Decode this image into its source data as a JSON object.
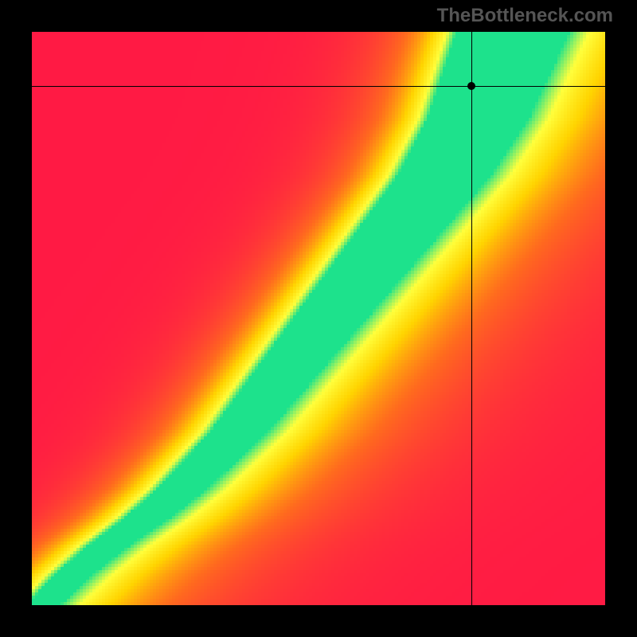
{
  "watermark": "TheBottleneck.com",
  "chart_data": {
    "type": "heatmap",
    "title": "",
    "xlabel": "",
    "ylabel": "",
    "xlim": [
      0,
      1
    ],
    "ylim": [
      0,
      1
    ],
    "grid": false,
    "legend": false,
    "colormap": [
      {
        "t": 0.0,
        "color": "#ff1a44"
      },
      {
        "t": 0.28,
        "color": "#ff6a1e"
      },
      {
        "t": 0.55,
        "color": "#ffd400"
      },
      {
        "t": 0.78,
        "color": "#ffff3c"
      },
      {
        "t": 1.0,
        "color": "#1de28c"
      }
    ],
    "ridge": {
      "description": "Green ridge path (x as function of y), value=1 along this curve, falloff with distance",
      "points": [
        {
          "y": 0.0,
          "x": 0.02
        },
        {
          "y": 0.05,
          "x": 0.07
        },
        {
          "y": 0.1,
          "x": 0.13
        },
        {
          "y": 0.15,
          "x": 0.2
        },
        {
          "y": 0.2,
          "x": 0.26
        },
        {
          "y": 0.25,
          "x": 0.31
        },
        {
          "y": 0.3,
          "x": 0.36
        },
        {
          "y": 0.35,
          "x": 0.4
        },
        {
          "y": 0.4,
          "x": 0.44
        },
        {
          "y": 0.45,
          "x": 0.48
        },
        {
          "y": 0.5,
          "x": 0.52
        },
        {
          "y": 0.55,
          "x": 0.56
        },
        {
          "y": 0.6,
          "x": 0.6
        },
        {
          "y": 0.65,
          "x": 0.64
        },
        {
          "y": 0.7,
          "x": 0.68
        },
        {
          "y": 0.75,
          "x": 0.72
        },
        {
          "y": 0.8,
          "x": 0.75
        },
        {
          "y": 0.85,
          "x": 0.78
        },
        {
          "y": 0.9,
          "x": 0.8
        },
        {
          "y": 0.95,
          "x": 0.82
        },
        {
          "y": 1.0,
          "x": 0.84
        }
      ],
      "width_base": 0.03,
      "width_gain": 0.07
    },
    "background_falloff": {
      "left_rate": 2.4,
      "right_rate": 1.1
    },
    "marker": {
      "x": 0.766,
      "y": 0.905
    },
    "crosshair": {
      "x": 0.766,
      "y": 0.905
    },
    "resolution": 180
  }
}
